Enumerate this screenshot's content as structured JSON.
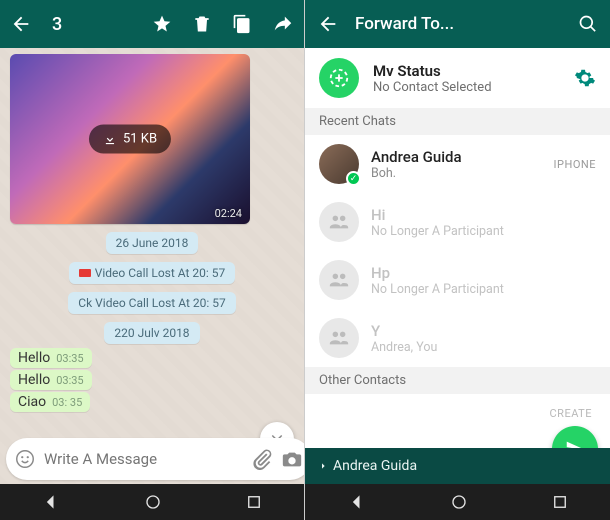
{
  "left": {
    "selected_count": "3",
    "media": {
      "size": "51 KB",
      "time": "02:24"
    },
    "date1": "26 June 2018",
    "sys1": "Video Call Lost At 20: 57",
    "sys2": "Ck Video Call Lost At 20: 57",
    "date2": "220 Julv 2018",
    "msgs": [
      {
        "text": "Hello",
        "time": "03:35"
      },
      {
        "text": "Hello",
        "time": "03:35"
      },
      {
        "text": "Ciao",
        "time": "03: 35"
      }
    ],
    "composer_placeholder": "Write A Message"
  },
  "right": {
    "title": "Forward To...",
    "status_title": "Mv Status",
    "status_sub": "No Contact Selected",
    "section_recent": "Recent Chats",
    "section_other": "Other Contacts",
    "create_hint": "CREATE",
    "rows": [
      {
        "name": "Andrea Guida",
        "sub": "Boh.",
        "right": "IPHONE"
      },
      {
        "name": "Hi",
        "sub": "No Longer A Participant"
      },
      {
        "name": "Hp",
        "sub": "No Longer A Participant"
      },
      {
        "name": "Y",
        "sub": "Andrea, You"
      }
    ],
    "selected_bar": "Andrea Guida"
  }
}
